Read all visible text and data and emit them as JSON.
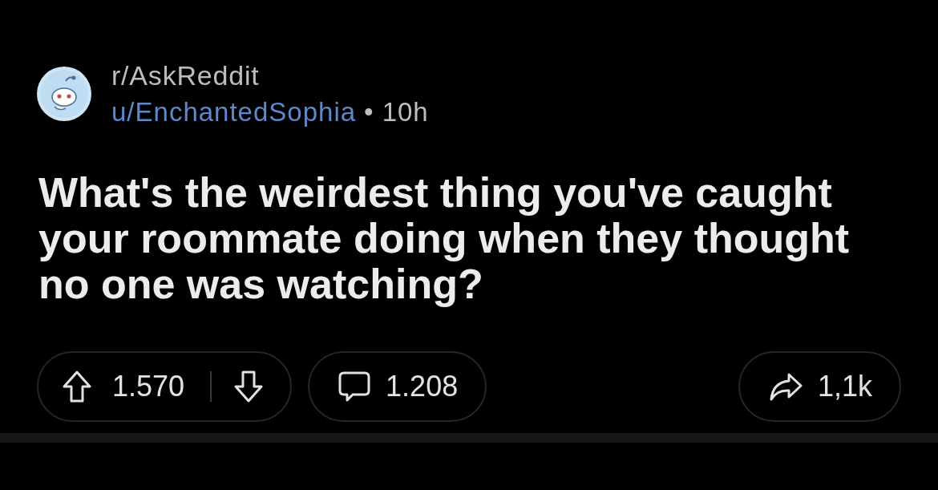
{
  "post": {
    "subreddit": "r/AskReddit",
    "author": "u/EnchantedSophia",
    "separator": "•",
    "age": "10h",
    "title": "What's the weirdest thing you've caught your roommate doing when they thought no one was watching?"
  },
  "actions": [
    {
      "kind": "vote",
      "count": "1.570"
    },
    {
      "kind": "comments",
      "count": "1.208"
    },
    {
      "kind": "share",
      "count": "1,1k"
    }
  ]
}
